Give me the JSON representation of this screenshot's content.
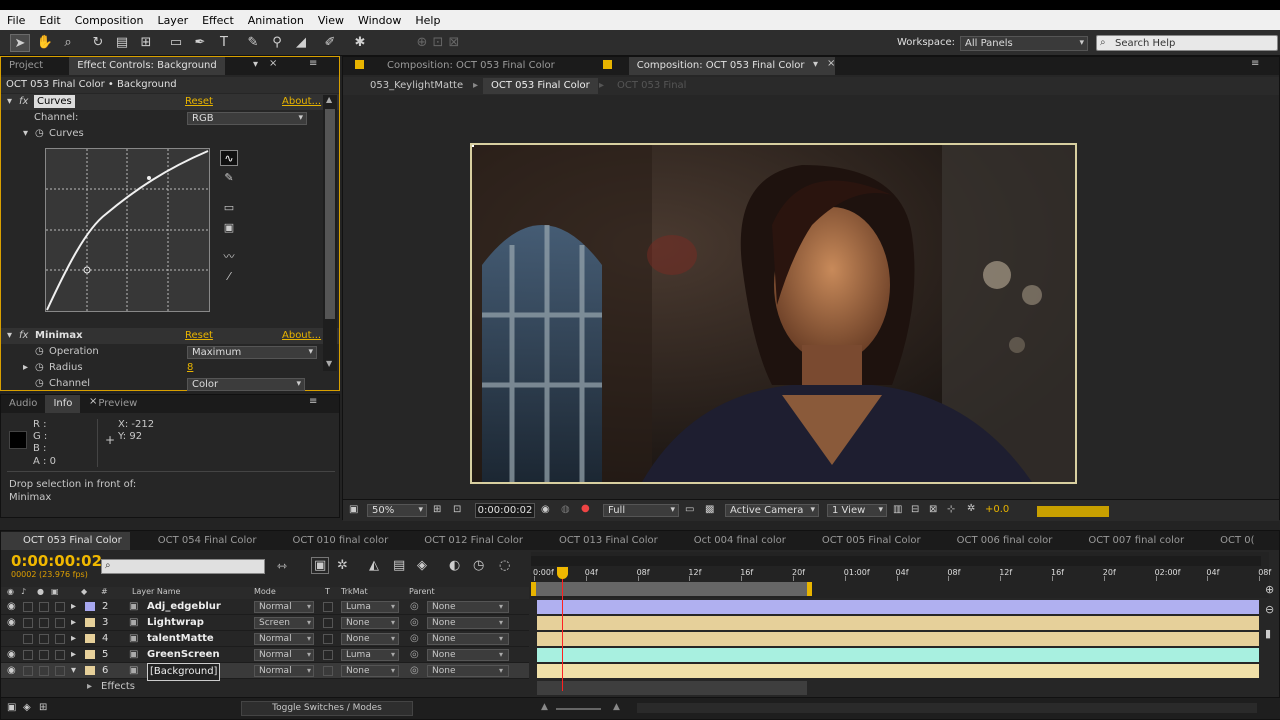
{
  "menu": [
    "File",
    "Edit",
    "Composition",
    "Layer",
    "Effect",
    "Animation",
    "View",
    "Window",
    "Help"
  ],
  "toolbar": {
    "workspace_label": "Workspace:",
    "workspace_value": "All Panels",
    "search_placeholder": "Search Help"
  },
  "effect_controls": {
    "tab_project": "Project",
    "tab_label": "Effect Controls: Background",
    "header": "OCT 053 Final Color • Background",
    "curves_name": "Curves",
    "reset": "Reset",
    "about": "About...",
    "channel_label": "Channel:",
    "channel_value": "RGB",
    "curves_sub": "Curves",
    "minimax_name": "Minimax",
    "operation_label": "Operation",
    "operation_value": "Maximum",
    "radius_label": "Radius",
    "radius_value": "8",
    "channel2_label": "Channel",
    "channel2_value": "Color"
  },
  "info_panel": {
    "tabs": [
      "Audio",
      "Info",
      "Preview"
    ],
    "r": "R :",
    "g": "G :",
    "b": "B :",
    "a": "A : 0",
    "x": "X: -212",
    "y": "Y: 92",
    "message_line1": "Drop selection in front of:",
    "message_line2": "Minimax"
  },
  "composition": {
    "tab_inactive": "Composition: OCT 053 Final Color",
    "tab_active": "Composition: OCT 053 Final Color",
    "breadcrumbs": [
      "053_KeylightMatte",
      "OCT 053 Final Color",
      "OCT 053 Final"
    ],
    "zoom": "50%",
    "timecode": "0:00:00:02",
    "resolution": "Full",
    "camera": "Active Camera",
    "view": "1 View",
    "exposure": "+0.0"
  },
  "timeline": {
    "tabs": [
      "OCT 053 Final Color",
      "OCT 054 Final Color",
      "OCT 010 final color",
      "OCT 012 Final Color",
      "OCT 013 Final Color",
      "Oct 004 final color",
      "OCT 005 Final Color",
      "OCT 006 final color",
      "OCT 007 final color",
      "OCT 0("
    ],
    "timecode": "0:00:00:02",
    "frame_info": "00002 (23.976 fps)",
    "col_layer_name": "Layer Name",
    "col_mode": "Mode",
    "col_t": "T",
    "col_trkmat": "TrkMat",
    "col_parent": "Parent",
    "col_num": "#",
    "ruler": [
      "0:00f",
      "04f",
      "08f",
      "12f",
      "16f",
      "20f",
      "01:00f",
      "04f",
      "08f",
      "12f",
      "16f",
      "20f",
      "02:00f",
      "04f",
      "08f"
    ],
    "layers": [
      {
        "num": "2",
        "name": "Adj_edgeblur",
        "mode": "Normal",
        "trkmat": "Luma",
        "parent": "None",
        "color": "#b0b0f0"
      },
      {
        "num": "3",
        "name": "Lightwrap",
        "mode": "Screen",
        "trkmat": "None",
        "parent": "None",
        "color": "#e6d09a"
      },
      {
        "num": "4",
        "name": "talentMatte",
        "mode": "Normal",
        "trkmat": "None",
        "parent": "None",
        "color": "#e6d09a"
      },
      {
        "num": "5",
        "name": "GreenScreen",
        "mode": "Normal",
        "trkmat": "Luma",
        "parent": "None",
        "color": "#a8f0e0"
      },
      {
        "num": "6",
        "name": "[Background]",
        "mode": "Normal",
        "trkmat": "None",
        "parent": "None",
        "color": "#f0e0a8"
      }
    ],
    "effects_label": "Effects",
    "toggle_label": "Toggle Switches / Modes"
  }
}
